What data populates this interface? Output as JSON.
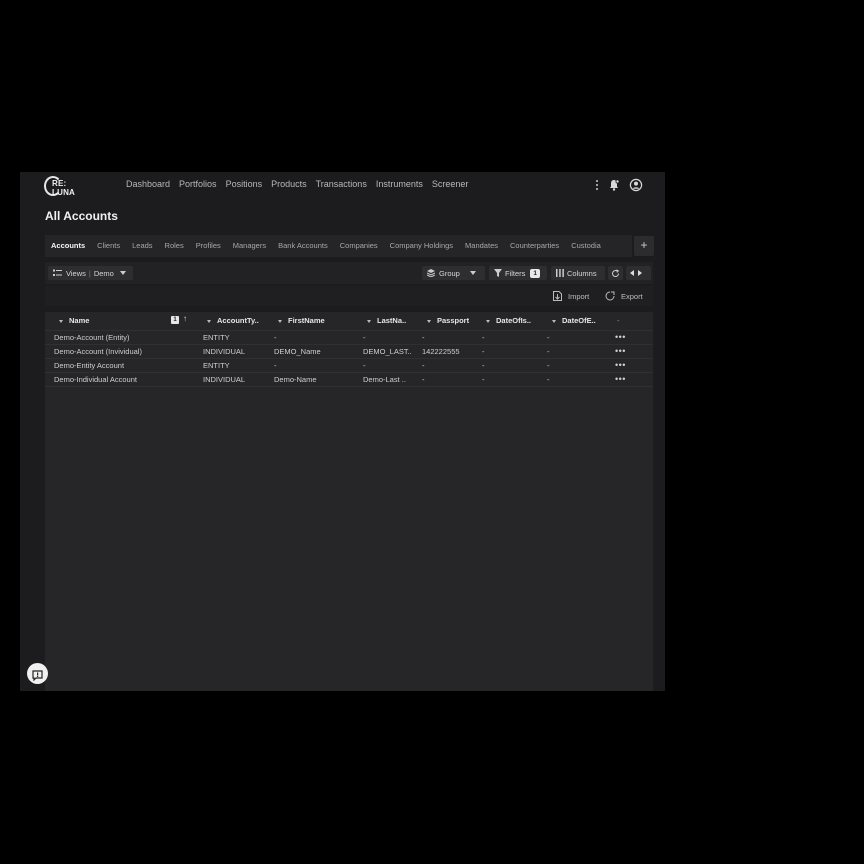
{
  "logo": {
    "line1": "RE:",
    "line2": "LUNA"
  },
  "nav": [
    "Dashboard",
    "Portfolios",
    "Positions",
    "Products",
    "Transactions",
    "Instruments",
    "Screener"
  ],
  "page_title": "All Accounts",
  "tabs": [
    "Accounts",
    "Clients",
    "Leads",
    "Roles",
    "Profiles",
    "Managers",
    "Bank Accounts",
    "Companies",
    "Company Holdings",
    "Mandates",
    "Counterparties",
    "Custodia"
  ],
  "tab_add_label": "+",
  "toolbar": {
    "views_label": "Views",
    "views_value": "Demo",
    "group_label": "Group",
    "filters_label": "Filters",
    "filters_count": "1",
    "columns_label": "Columns"
  },
  "actions": {
    "import_label": "Import",
    "export_label": "Export"
  },
  "table": {
    "columns": [
      "Name",
      "AccountTy..",
      "FirstName",
      "LastNa..",
      "Passport",
      "DateOfIs..",
      "DateOfE..",
      "-"
    ],
    "sort_badge": "1",
    "sort_arrow": "↑",
    "rows": [
      [
        "Demo-Account (Entity)",
        "ENTITY",
        "-",
        "-",
        "-",
        "-",
        "-"
      ],
      [
        "Demo-Account (Invividual)",
        "INDIVIDUAL",
        "DEMO_Name",
        "DEMO_LAST..",
        "142222555",
        "-",
        "-"
      ],
      [
        "Demo-Entity Account",
        "ENTITY",
        "-",
        "-",
        "-",
        "-",
        "-"
      ],
      [
        "Demo-Individual Account",
        "INDIVIDUAL",
        "Demo-Name",
        "Demo-Last ..",
        "-",
        "-",
        "-"
      ]
    ],
    "row_action": "•••"
  },
  "colors": {
    "app_bg": "#1c1c1e",
    "page_bg": "#000000",
    "accent": "#e8e8e8"
  },
  "icons": [
    "kebab-menu-icon",
    "notifications-icon",
    "user-avatar-icon",
    "list-views-icon",
    "stack-group-icon",
    "filter-icon",
    "columns-icon",
    "refresh-icon",
    "prev-icon",
    "next-icon",
    "import-file-icon",
    "export-icon",
    "feedback-icon"
  ]
}
